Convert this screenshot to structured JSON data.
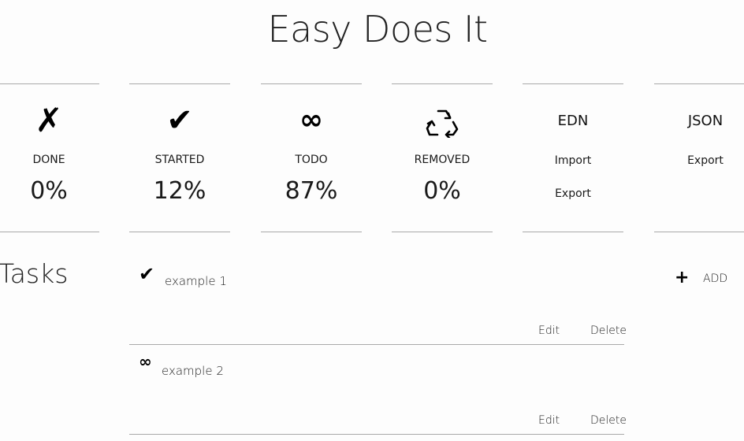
{
  "app": {
    "title": "Easy Does It"
  },
  "stats": [
    {
      "icon": "x-mark-icon",
      "glyph": "✗",
      "label": "DONE",
      "value": "0%"
    },
    {
      "icon": "check-mark-icon",
      "glyph": "✔",
      "label": "STARTED",
      "value": "12%"
    },
    {
      "icon": "infinity-icon",
      "glyph": "∞",
      "label": "TODO",
      "value": "87%"
    },
    {
      "icon": "recycle-icon",
      "glyph": "♺",
      "label": "REMOVED",
      "value": "0%"
    }
  ],
  "formats": {
    "edn": {
      "heading": "EDN",
      "import_label": "Import",
      "export_label": "Export"
    },
    "json": {
      "heading": "JSON",
      "export_label": "Export"
    }
  },
  "tasks_section": {
    "heading": "Tasks",
    "add_icon_glyph": "+",
    "add_label": "ADD",
    "items": [
      {
        "status_icon": "check-mark-icon",
        "glyph": "✔",
        "name": "example 1",
        "edit_label": "Edit",
        "delete_label": "Delete"
      },
      {
        "status_icon": "infinity-icon",
        "glyph": "∞",
        "name": "example 2",
        "edit_label": "Edit",
        "delete_label": "Delete"
      }
    ]
  }
}
